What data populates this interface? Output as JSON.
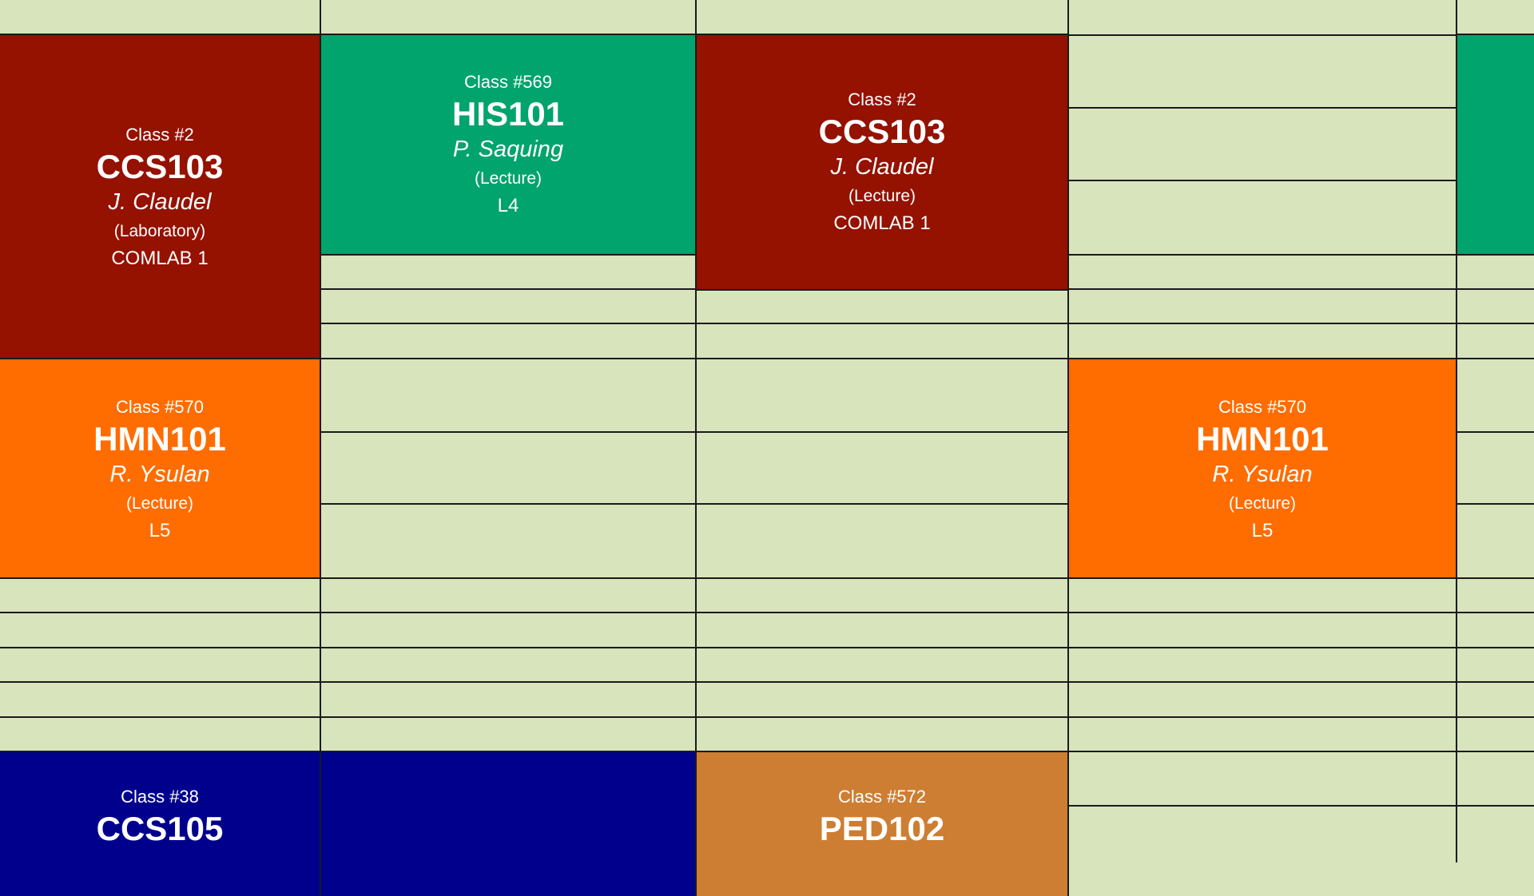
{
  "colors": {
    "grid_background": "#d8e4bc",
    "grid_lines": "#1a1a1a",
    "ccs103": "#951100",
    "his101": "#00a46c",
    "hmn101": "#ff6c00",
    "ccs105": "#00008c",
    "ped102": "#cd7e33"
  },
  "blocks": [
    {
      "class_no": "Class #2",
      "course": "CCS103",
      "teacher": "J. Claudel",
      "kind": "(Laboratory)",
      "room": "COMLAB 1"
    },
    {
      "class_no": "Class #569",
      "course": "HIS101",
      "teacher": "P. Saquing",
      "kind": "(Lecture)",
      "room": "L4"
    },
    {
      "class_no": "Class #2",
      "course": "CCS103",
      "teacher": "J. Claudel",
      "kind": "(Lecture)",
      "room": "COMLAB 1"
    },
    {
      "class_no": "Class #570",
      "course": "HMN101",
      "teacher": "R. Ysulan",
      "kind": "(Lecture)",
      "room": "L5"
    },
    {
      "class_no": "Class #570",
      "course": "HMN101",
      "teacher": "R. Ysulan",
      "kind": "(Lecture)",
      "room": "L5"
    },
    {
      "class_no": "Class #38",
      "course": "CCS105"
    },
    {
      "class_no": "Class #572",
      "course": "PED102"
    }
  ]
}
